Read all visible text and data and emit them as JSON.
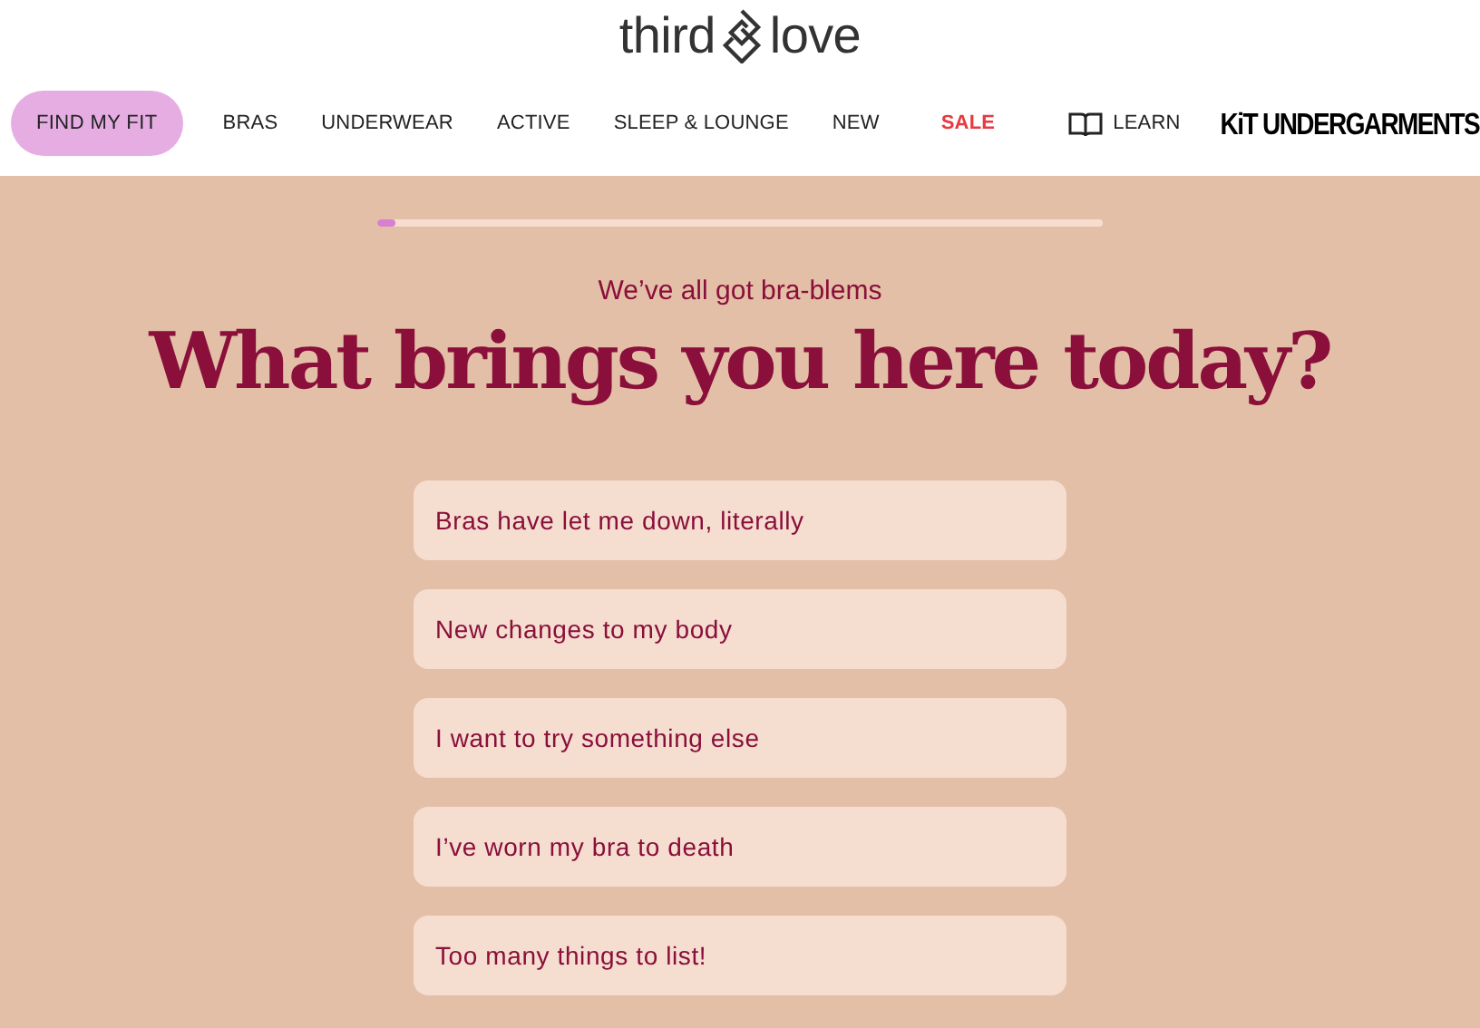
{
  "logo": {
    "left": "third",
    "right": "love"
  },
  "nav": [
    {
      "label": "FIND MY FIT",
      "kind": "button"
    },
    {
      "label": "BRAS",
      "kind": "link"
    },
    {
      "label": "UNDERWEAR",
      "kind": "link"
    },
    {
      "label": "ACTIVE",
      "kind": "link"
    },
    {
      "label": "SLEEP & LOUNGE",
      "kind": "link"
    },
    {
      "label": "NEW",
      "kind": "link"
    },
    {
      "label": "SALE",
      "kind": "sale"
    },
    {
      "label": "LEARN",
      "kind": "learn"
    },
    {
      "label": "KiT UNDERGARMENTS",
      "kind": "brand"
    }
  ],
  "progress": {
    "level": 0.025
  },
  "subtitle": "We’ve all got bra-blems",
  "heading": "What brings you here today?",
  "options": [
    "Bras have let me down, literally",
    "New changes to my body",
    "I want to try something else",
    "I’ve worn my bra to death",
    "Too many things to list!"
  ]
}
